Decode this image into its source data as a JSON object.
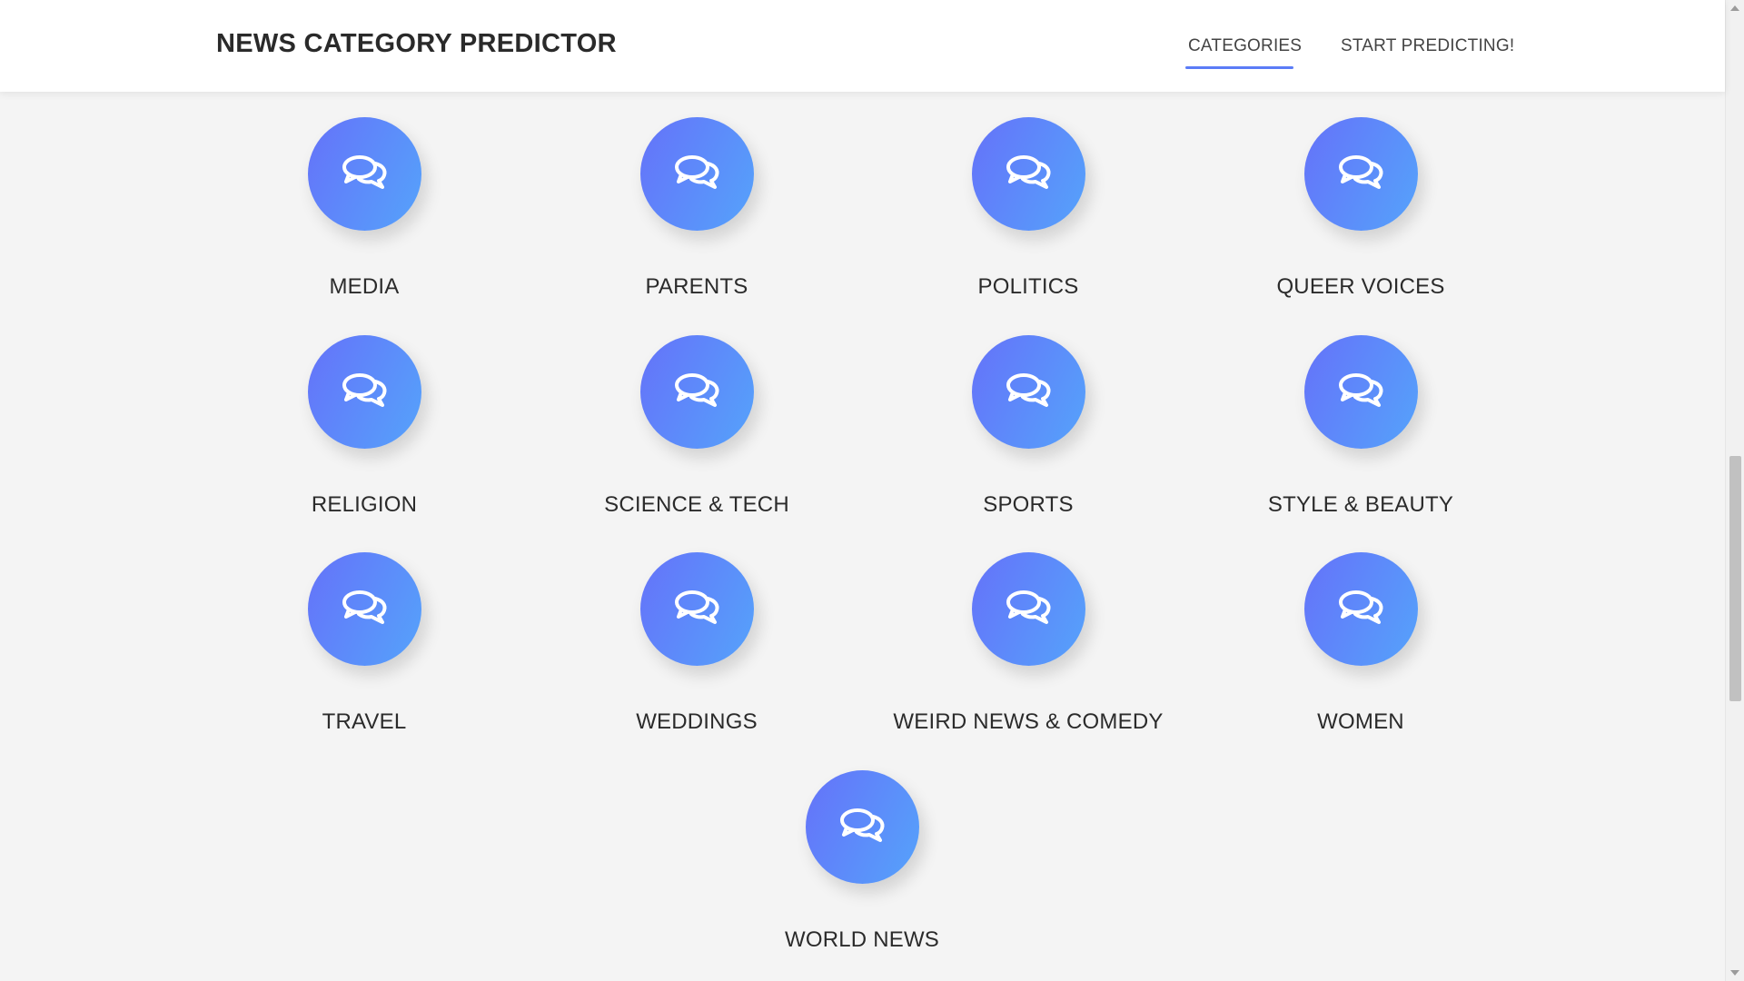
{
  "header": {
    "brand": "NEWS CATEGORY PREDICTOR",
    "nav": [
      {
        "label": "CATEGORIES",
        "active": true
      },
      {
        "label": "START PREDICTING!",
        "active": false
      }
    ]
  },
  "categories": [
    {
      "label": "MEDIA",
      "icon": "chat-bubbles-icon"
    },
    {
      "label": "PARENTS",
      "icon": "chat-bubbles-icon"
    },
    {
      "label": "POLITICS",
      "icon": "chat-bubbles-icon"
    },
    {
      "label": "QUEER VOICES",
      "icon": "chat-bubbles-icon"
    },
    {
      "label": "RELIGION",
      "icon": "chat-bubbles-icon"
    },
    {
      "label": "SCIENCE & TECH",
      "icon": "chat-bubbles-icon"
    },
    {
      "label": "SPORTS",
      "icon": "chat-bubbles-icon"
    },
    {
      "label": "STYLE & BEAUTY",
      "icon": "chat-bubbles-icon"
    },
    {
      "label": "TRAVEL",
      "icon": "chat-bubbles-icon"
    },
    {
      "label": "WEDDINGS",
      "icon": "chat-bubbles-icon"
    },
    {
      "label": "WEIRD NEWS & COMEDY",
      "icon": "chat-bubbles-icon"
    },
    {
      "label": "WOMEN",
      "icon": "chat-bubbles-icon"
    },
    {
      "label": "WORLD NEWS",
      "icon": "chat-bubbles-icon"
    }
  ],
  "colors": {
    "gradient_start": "#6572f9",
    "gradient_end": "#55a3fb",
    "nav_active_underline": "#5b7cf7",
    "background": "#f4f4f4"
  }
}
